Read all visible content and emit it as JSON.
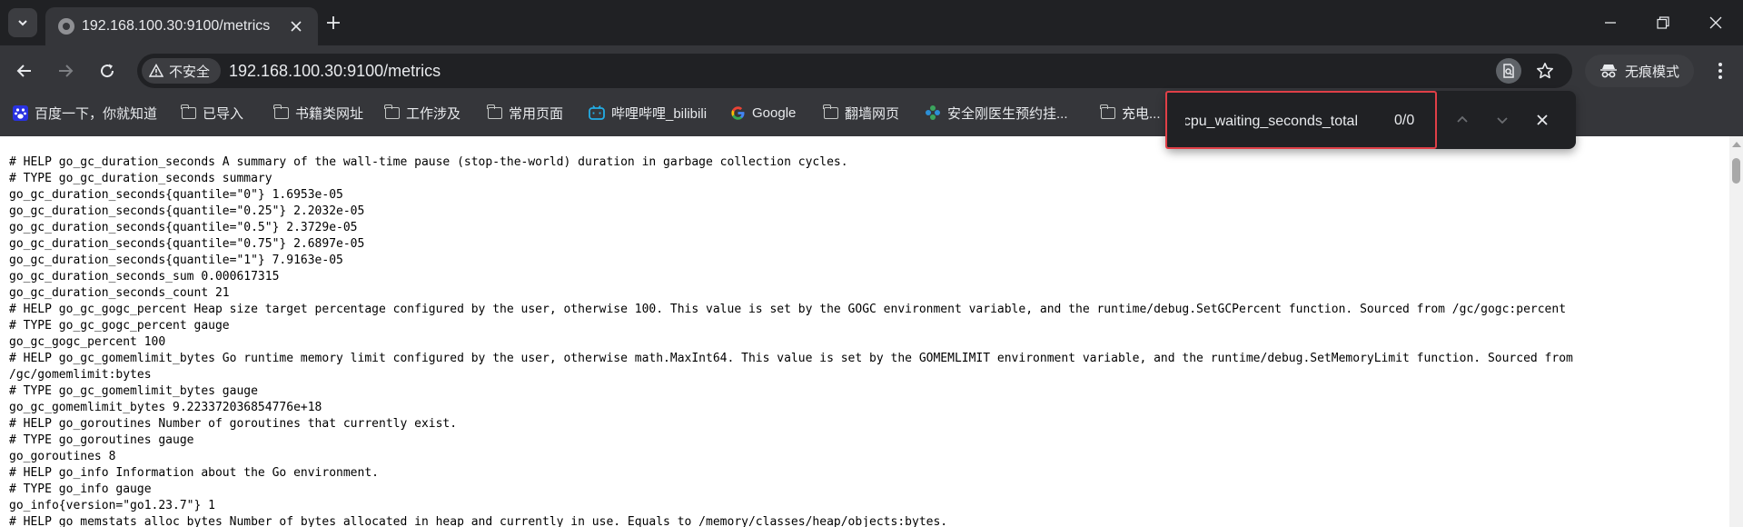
{
  "browser": {
    "tab": {
      "title": "192.168.100.30:9100/metrics"
    },
    "address": {
      "security_label": "不安全",
      "url": "192.168.100.30:9100/metrics"
    },
    "incognito_label": "无痕模式"
  },
  "bookmarks": [
    {
      "label": "百度一下，你就知道",
      "icon": "baidu-paw-icon"
    },
    {
      "label": "已导入",
      "icon": "folder-icon"
    },
    {
      "label": "书籍类网址",
      "icon": "folder-icon"
    },
    {
      "label": "工作涉及",
      "icon": "folder-icon"
    },
    {
      "label": "常用页面",
      "icon": "folder-icon"
    },
    {
      "label": "哔哩哔哩_bilibili",
      "icon": "bilibili-icon"
    },
    {
      "label": "Google",
      "icon": "google-icon"
    },
    {
      "label": "翻墙网页",
      "icon": "folder-icon"
    },
    {
      "label": "安全刚医生预约挂...",
      "icon": "pinwheel-icon"
    },
    {
      "label": "充电...",
      "icon": "folder-icon"
    }
  ],
  "find_bar": {
    "query": "node_cpu_waiting_seconds_total",
    "count": "0/0"
  },
  "colors": {
    "tabstrip": "#202124",
    "toolbar": "#35363a",
    "highlight_border": "#e03f47"
  },
  "metrics_lines": [
    "# HELP go_gc_duration_seconds A summary of the wall-time pause (stop-the-world) duration in garbage collection cycles.",
    "# TYPE go_gc_duration_seconds summary",
    "go_gc_duration_seconds{quantile=\"0\"} 1.6953e-05",
    "go_gc_duration_seconds{quantile=\"0.25\"} 2.2032e-05",
    "go_gc_duration_seconds{quantile=\"0.5\"} 2.3729e-05",
    "go_gc_duration_seconds{quantile=\"0.75\"} 2.6897e-05",
    "go_gc_duration_seconds{quantile=\"1\"} 7.9163e-05",
    "go_gc_duration_seconds_sum 0.000617315",
    "go_gc_duration_seconds_count 21",
    "# HELP go_gc_gogc_percent Heap size target percentage configured by the user, otherwise 100. This value is set by the GOGC environment variable, and the runtime/debug.SetGCPercent function. Sourced from /gc/gogc:percent",
    "# TYPE go_gc_gogc_percent gauge",
    "go_gc_gogc_percent 100",
    "# HELP go_gc_gomemlimit_bytes Go runtime memory limit configured by the user, otherwise math.MaxInt64. This value is set by the GOMEMLIMIT environment variable, and the runtime/debug.SetMemoryLimit function. Sourced from",
    "/gc/gomemlimit:bytes",
    "# TYPE go_gc_gomemlimit_bytes gauge",
    "go_gc_gomemlimit_bytes 9.223372036854776e+18",
    "# HELP go_goroutines Number of goroutines that currently exist.",
    "# TYPE go_goroutines gauge",
    "go_goroutines 8",
    "# HELP go_info Information about the Go environment.",
    "# TYPE go_info gauge",
    "go_info{version=\"go1.23.7\"} 1",
    "# HELP go_memstats_alloc_bytes Number of bytes allocated in heap and currently in use. Equals to /memory/classes/heap/objects:bytes."
  ]
}
